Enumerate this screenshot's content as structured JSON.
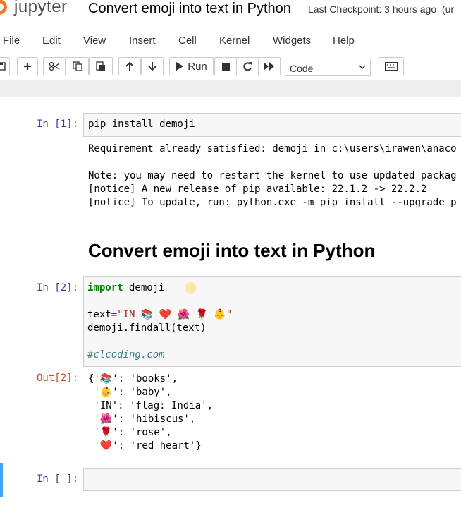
{
  "header": {
    "logo_text": "jupyter",
    "notebook_title": "Convert emoji into text in Python",
    "checkpoint": "Last Checkpoint: 3 hours ago",
    "extra": "(ur"
  },
  "menu": [
    "File",
    "Edit",
    "View",
    "Insert",
    "Cell",
    "Kernel",
    "Widgets",
    "Help"
  ],
  "toolbar": {
    "run_label": "Run",
    "cell_type": "Code"
  },
  "cells": {
    "c1": {
      "prompt": "In [1]:",
      "code": "pip install demoji",
      "output": [
        "Requirement already satisfied: demoji in c:\\users\\irawen\\anaco",
        "",
        "Note: you may need to restart the kernel to use updated packag",
        "[notice] A new release of pip available: 22.1.2 -> 22.2.2",
        "[notice] To update, run: python.exe -m pip install --upgrade p"
      ]
    },
    "markdown_heading": "Convert emoji into text in Python",
    "c2": {
      "prompt": "In [2]:",
      "kw_import": "import",
      "import_rest": " demoji",
      "text_assign": "text=",
      "text_string": "\"IN 📚 ❤️ 🌺 🌹 👶\"",
      "findall": "demoji.findall(text)",
      "comment": "#clcoding.com",
      "out_prompt": "Out[2]:",
      "out_lines": [
        "{'📚': 'books',",
        " '👶': 'baby',",
        " 'IN': 'flag: India',",
        " '🌺': 'hibiscus',",
        " '🌹': 'rose',",
        " '❤️': 'red heart'}"
      ]
    },
    "c3": {
      "prompt": "In [ ]:"
    }
  },
  "colors": {
    "accent": "#f37726",
    "prompt_in": "#303f9f",
    "prompt_out": "#d84315",
    "selected": "#42a5f5"
  }
}
